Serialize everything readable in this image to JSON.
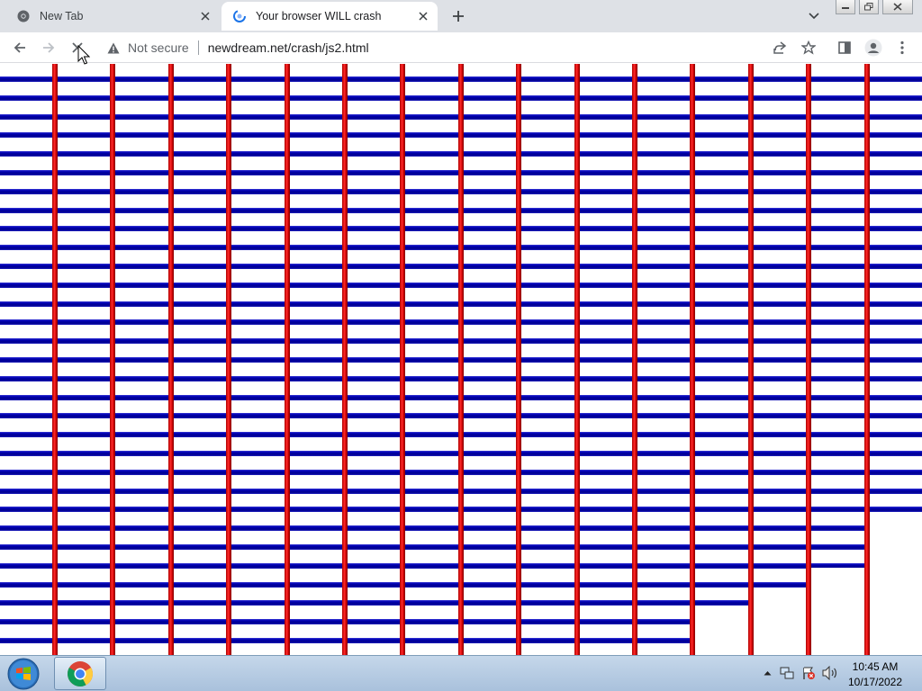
{
  "tabs": [
    {
      "title": "New Tab",
      "favicon": "chrome-icon",
      "active": false
    },
    {
      "title": "Your browser WILL crash",
      "favicon": "page-loading-icon",
      "active": true
    }
  ],
  "toolbar": {
    "security_label": "Not secure",
    "url": "newdream.net/crash/js2.html"
  },
  "content": {
    "line_colors": {
      "horizontal": "#0000b0",
      "vertical": "#e00000"
    }
  },
  "taskbar": {
    "time": "10:45 AM",
    "date": "10/17/2022",
    "pinned_app": "chrome-icon"
  }
}
